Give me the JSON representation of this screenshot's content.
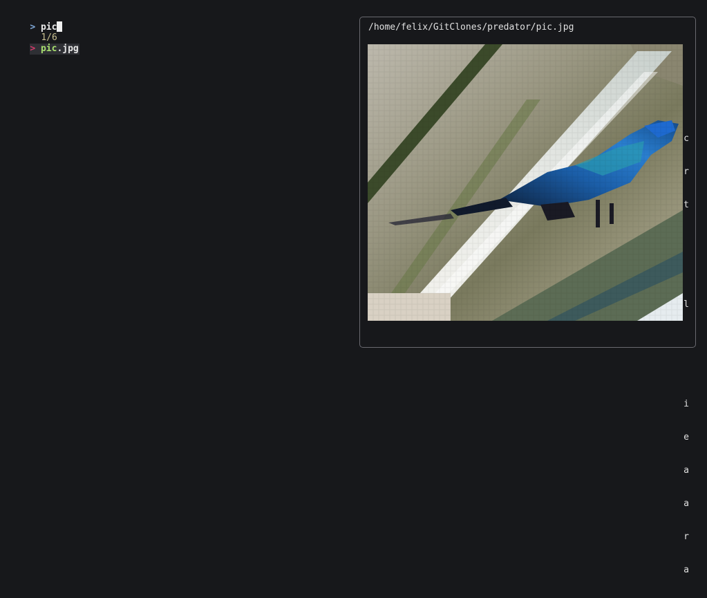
{
  "finder": {
    "prompt_symbol": ">",
    "query": "pic",
    "match_count": "1/6",
    "pointer_symbol": ">",
    "selected_item": {
      "match": "pic",
      "rest": ".jpg"
    }
  },
  "preview": {
    "path": "/home/felix/GitClones/predator/pic.jpg",
    "image_subject": "blue bird perched on a diagonal branch (pixelated terminal render)",
    "edge_glyphs": [
      "c",
      "r",
      "t",
      "",
      "",
      "l",
      "",
      "",
      "i",
      "e",
      "a",
      "a",
      "r",
      "a"
    ]
  },
  "colors": {
    "background": "#17181b",
    "prompt": "#7fa8d8",
    "pointer": "#d03a6a",
    "match_highlight": "#a9e070",
    "count": "#c8c090",
    "border": "#6a6a70"
  }
}
